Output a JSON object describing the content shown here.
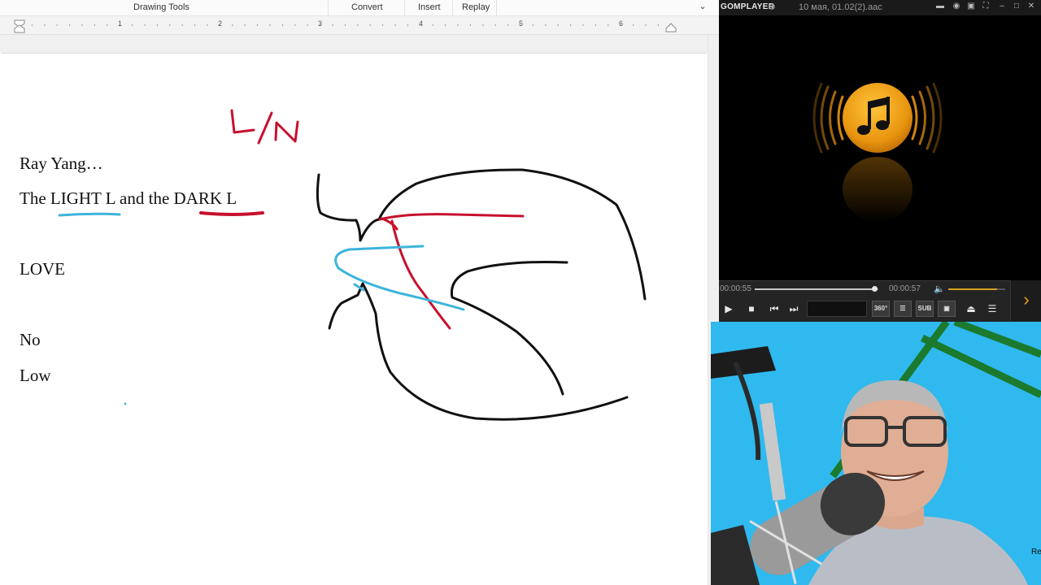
{
  "word": {
    "ribbon_tabs": [
      "Drawing Tools",
      "Convert",
      "Insert",
      "Replay"
    ],
    "ruler_numbers": [
      "1",
      "2",
      "3",
      "4",
      "5",
      "6"
    ],
    "document_lines": [
      "Ray Yang…",
      "The LIGHT L and the DARK L",
      "LOVE",
      "No",
      "Low"
    ],
    "handwritten_label": "L/N",
    "ink_colors": {
      "black": "#111111",
      "red": "#c8102e",
      "blue": "#3cb4dc"
    }
  },
  "player": {
    "logo": "GOMPLAYER",
    "filename": "10 мая, 01.02(2).aac",
    "time_elapsed": "00:00:55",
    "time_total": "00:00:57",
    "progress": 0.965,
    "volume": 0.85,
    "sub_label": "SUB",
    "vr_label": "360°",
    "accent_color": "#f2a11b"
  },
  "webcam": {
    "background_color": "#2fb9ef",
    "corner_text": "Re"
  }
}
